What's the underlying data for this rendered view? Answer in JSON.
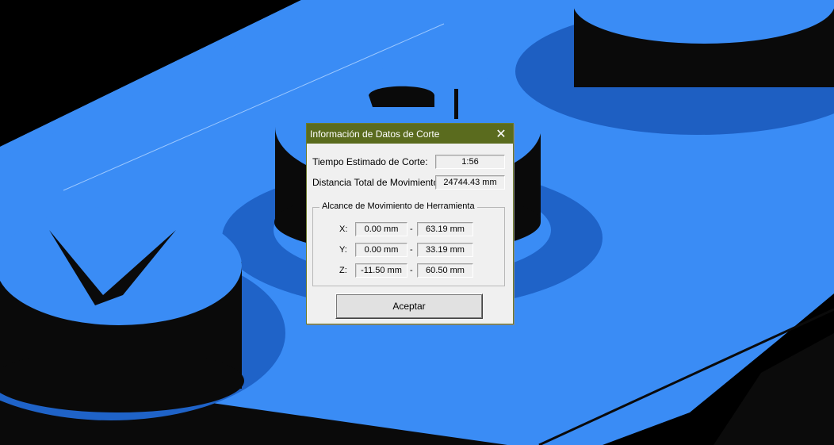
{
  "dialog": {
    "title": "Información de Datos de Corte",
    "close_icon": "close-icon",
    "time_label": "Tiempo Estimado de Corte:",
    "time_value": "1:56",
    "distance_label": "Distancia Total de Movimiento:",
    "distance_value": "24744.43 mm",
    "group_title": "Alcance de Movimiento de Herramienta",
    "ranges": [
      {
        "axis": "X:",
        "min": "0.00 mm",
        "sep": "-",
        "max": "63.19 mm"
      },
      {
        "axis": "Y:",
        "min": "0.00 mm",
        "sep": "-",
        "max": "33.19 mm"
      },
      {
        "axis": "Z:",
        "min": "-11.50 mm",
        "sep": "-",
        "max": "60.50 mm"
      }
    ],
    "ok_label": "Aceptar"
  },
  "colors": {
    "model_blue": "#3a8cf5",
    "titlebar": "#5a6b1e",
    "dialog_bg": "#f0f0f0"
  }
}
